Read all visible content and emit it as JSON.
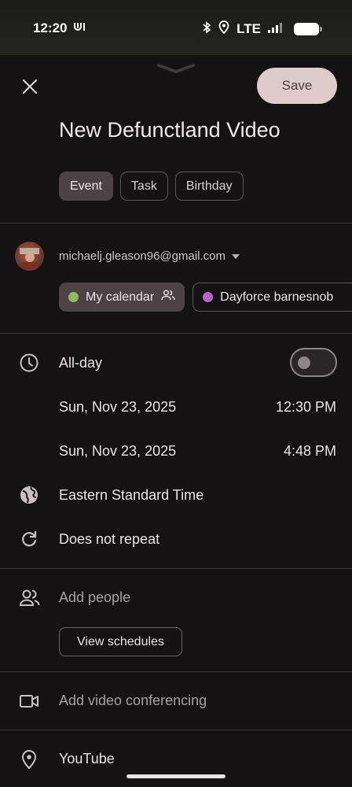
{
  "status_bar": {
    "time": "12:20",
    "network": "LTE"
  },
  "toolbar": {
    "save_label": "Save"
  },
  "event": {
    "title": "New Defunctland Video",
    "types": [
      {
        "label": "Event",
        "active": true
      },
      {
        "label": "Task",
        "active": false
      },
      {
        "label": "Birthday",
        "active": false
      }
    ]
  },
  "account": {
    "email": "michaelj.gleason96@gmail.com",
    "calendars": [
      {
        "label": "My calendar",
        "color": "#8bbd5a"
      },
      {
        "label": "Dayforce barnesnob",
        "color": "#b565c9"
      }
    ]
  },
  "schedule": {
    "all_day_label": "All-day",
    "start_date": "Sun, Nov 23, 2025",
    "start_time": "12:30 PM",
    "end_date": "Sun, Nov 23, 2025",
    "end_time": "4:48 PM",
    "timezone": "Eastern Standard Time",
    "repeat": "Does not repeat"
  },
  "people": {
    "placeholder": "Add people",
    "view_schedules_label": "View schedules"
  },
  "conferencing": {
    "placeholder": "Add video conferencing"
  },
  "location": {
    "value": "YouTube"
  }
}
